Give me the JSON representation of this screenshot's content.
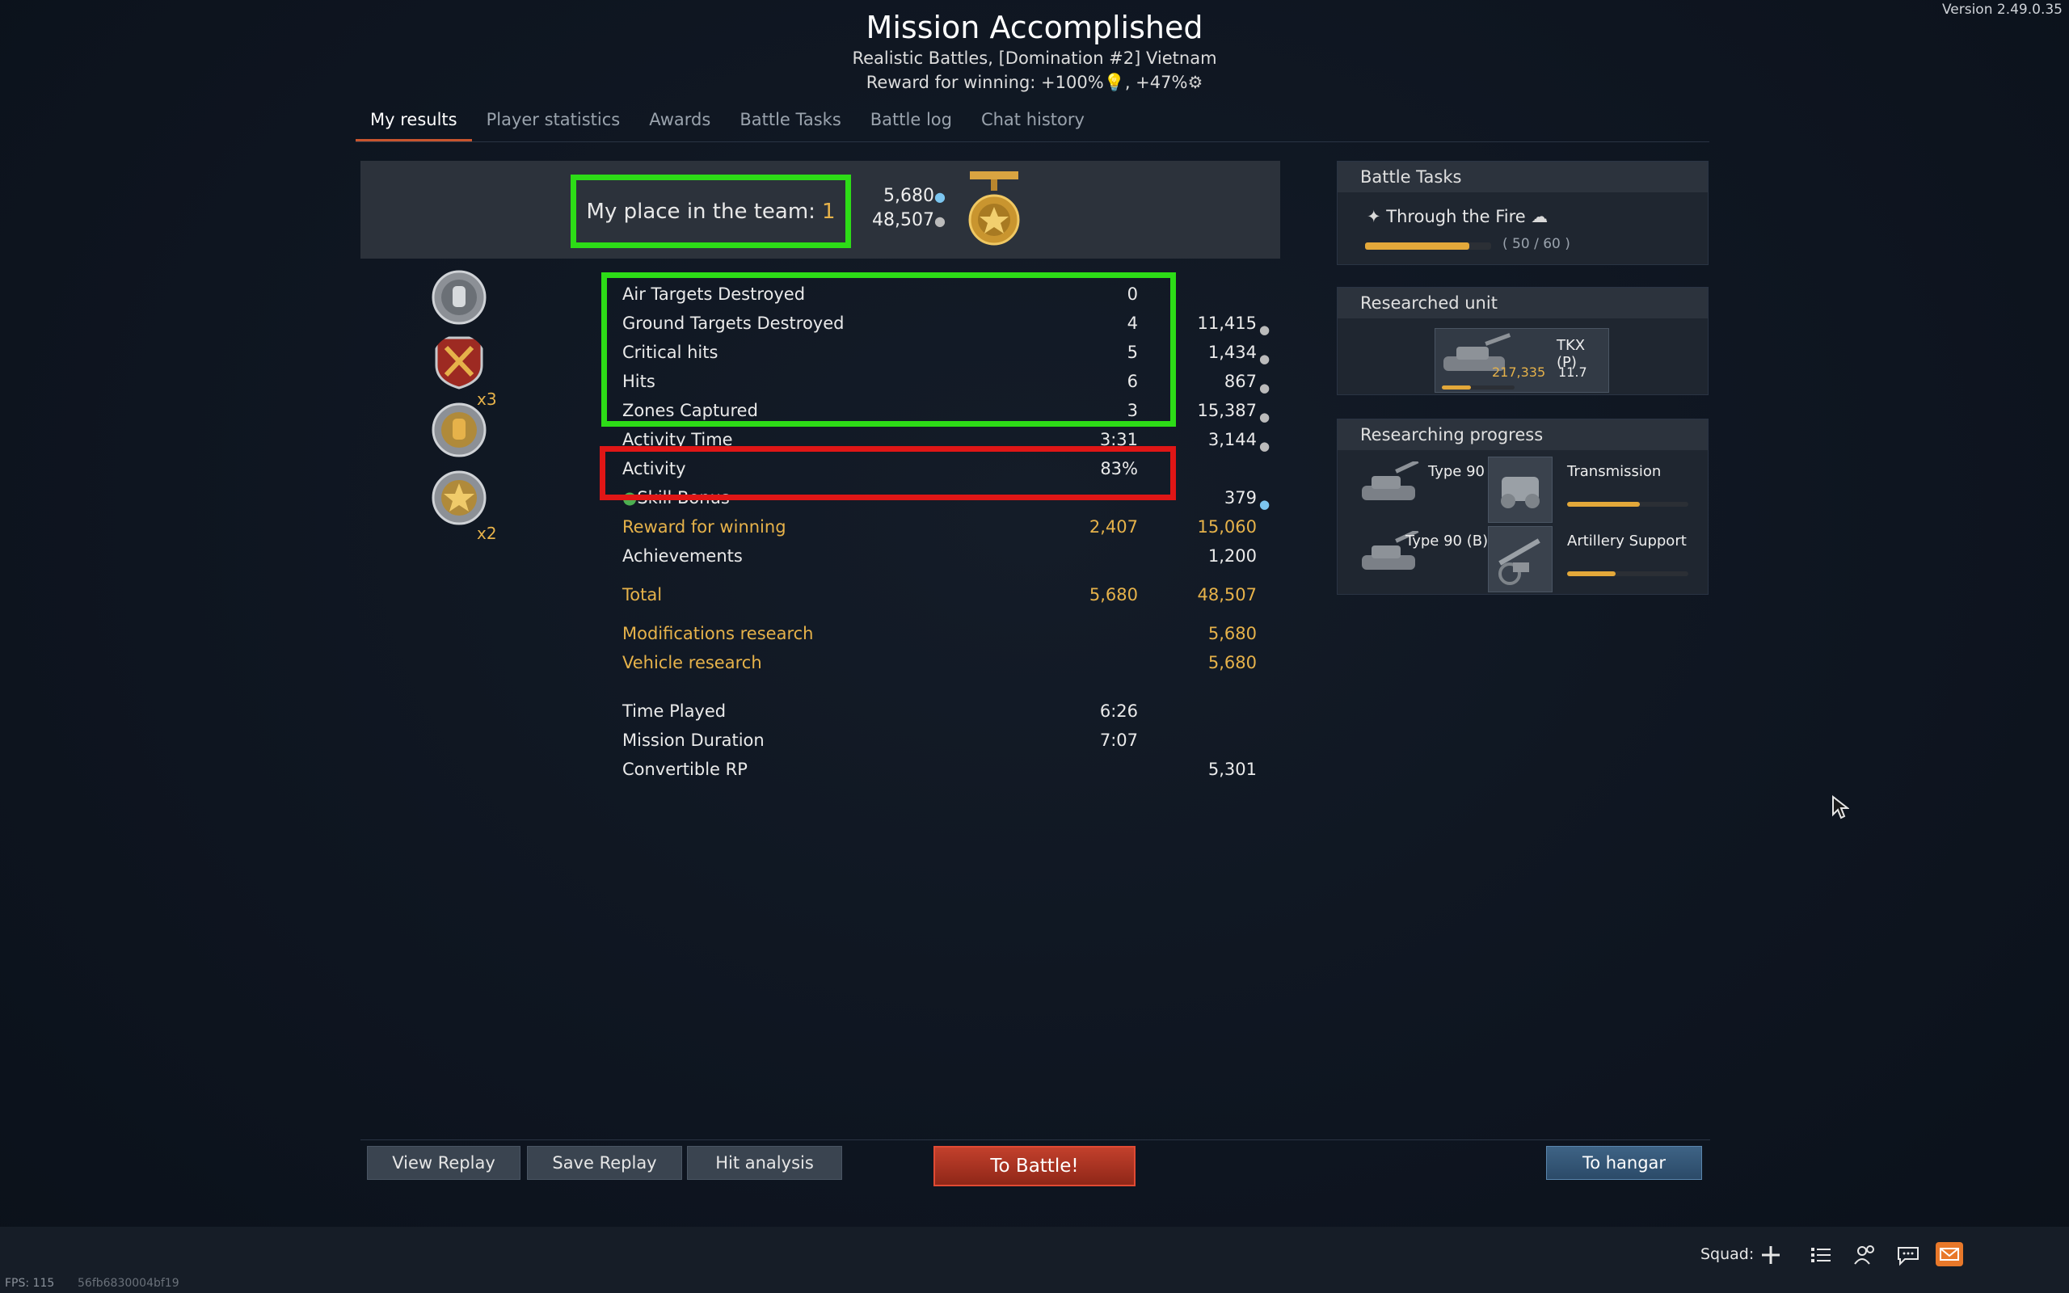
{
  "version": "Version 2.49.0.35",
  "header": {
    "title": "Mission Accomplished",
    "subtitle": "Realistic Battles, [Domination #2] Vietnam",
    "reward_prefix": "Reward for winning: +100%",
    "reward_mid": ", +47%"
  },
  "tabs": [
    "My results",
    "Player statistics",
    "Awards",
    "Battle Tasks",
    "Battle log",
    "Chat history"
  ],
  "place": {
    "label": "My place in the team:",
    "value": "1",
    "rp": "5,680",
    "sl": "48,507"
  },
  "awards": [
    {
      "icon": "silver-fist-medal-icon",
      "mult": ""
    },
    {
      "icon": "red-crossed-swords-shield-icon",
      "mult": "x3"
    },
    {
      "icon": "gold-fist-medal-icon",
      "mult": ""
    },
    {
      "icon": "gold-star-medal-icon",
      "mult": "x2"
    }
  ],
  "stats": [
    {
      "label": "Air Targets Destroyed",
      "value": "0",
      "reward": ""
    },
    {
      "label": "Ground Targets Destroyed",
      "value": "4",
      "reward": "11,415"
    },
    {
      "label": "Critical hits",
      "value": "5",
      "reward": "1,434"
    },
    {
      "label": "Hits",
      "value": "6",
      "reward": "867"
    },
    {
      "label": "Zones Captured",
      "value": "3",
      "reward": "15,387"
    },
    {
      "label": "Activity Time",
      "value": "3:31",
      "reward": "3,144"
    },
    {
      "label": "Activity",
      "value": "83%",
      "reward": ""
    },
    {
      "label": "Skill Bonus",
      "value": "",
      "reward": "379"
    },
    {
      "label": "Reward for winning",
      "value": "2,407",
      "reward": "15,060"
    },
    {
      "label": "Achievements",
      "value": "",
      "reward": "1,200"
    }
  ],
  "totals": {
    "total_label": "Total",
    "total_rp": "5,680",
    "total_sl": "48,507",
    "mod_label": "Modifications research",
    "mod_rp": "5,680",
    "veh_label": "Vehicle research",
    "veh_rp": "5,680"
  },
  "times": [
    {
      "label": "Time Played",
      "value": "6:26",
      "reward": ""
    },
    {
      "label": "Mission Duration",
      "value": "7:07",
      "reward": ""
    },
    {
      "label": "Convertible RP",
      "value": "",
      "reward": "5,301"
    }
  ],
  "battle_tasks": {
    "header": "Battle Tasks",
    "task_name": "Through the Fire",
    "progress_text": "( 50 / 60 )",
    "progress": 0.83
  },
  "researched_unit": {
    "header": "Researched unit",
    "name": "TKX (P)",
    "rp": "217,335",
    "br": "11.7"
  },
  "researching": {
    "header": "Researching progress",
    "items": [
      {
        "vehicle": "Type 90",
        "module": "Transmission",
        "progress": 0.6
      },
      {
        "vehicle": "Type 90 (B)",
        "module": "Artillery Support",
        "progress": 0.4
      }
    ]
  },
  "buttons": {
    "view_replay": "View Replay",
    "save_replay": "Save Replay",
    "hit_analysis": "Hit analysis",
    "to_battle": "To Battle!",
    "to_hangar": "To hangar"
  },
  "bottom": {
    "squad": "Squad:",
    "fps": "FPS: 115",
    "session": "56fb6830004bf19"
  },
  "colors": {
    "accent_gold": "#e6b24a",
    "highlight_green": "#2ddc17",
    "highlight_red": "#e01616",
    "battle_red": "#c2402c"
  }
}
